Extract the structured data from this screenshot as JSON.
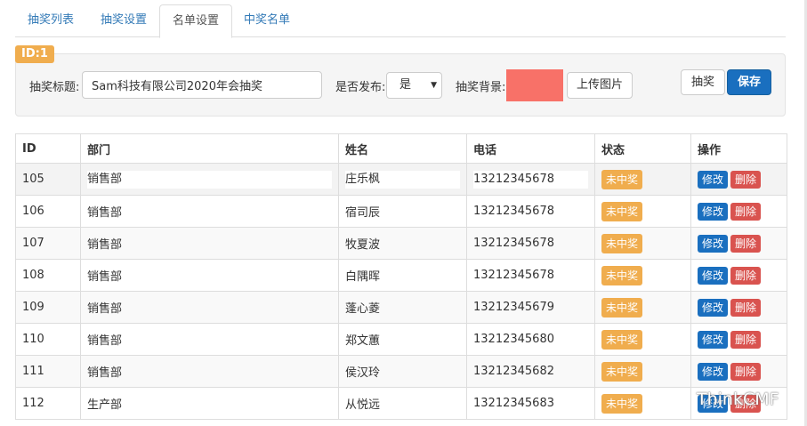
{
  "tabs": [
    "抽奖列表",
    "抽奖设置",
    "名单设置",
    "中奖名单"
  ],
  "active_tab": 2,
  "form": {
    "id_badge": "ID:1",
    "title_label": "抽奖标题:",
    "title_value": "Sam科技有限公司2020年会抽奖",
    "publish_label": "是否发布:",
    "publish_value": "是",
    "bg_label": "抽奖背景:",
    "bg_color": "#f87168",
    "upload_button": "上传图片",
    "draw_button": "抽奖",
    "save_button": "保存"
  },
  "table": {
    "headers": [
      "ID",
      "部门",
      "姓名",
      "电话",
      "状态",
      "操作"
    ],
    "rows": [
      {
        "id": "105",
        "dept": "销售部",
        "name": "庄乐枫",
        "phone": "13212345678",
        "status": "未中奖",
        "edit": "修改",
        "del": "删除"
      },
      {
        "id": "106",
        "dept": "销售部",
        "name": "宿司辰",
        "phone": "13212345678",
        "status": "未中奖",
        "edit": "修改",
        "del": "删除"
      },
      {
        "id": "107",
        "dept": "销售部",
        "name": "牧夏波",
        "phone": "13212345678",
        "status": "未中奖",
        "edit": "修改",
        "del": "删除"
      },
      {
        "id": "108",
        "dept": "销售部",
        "name": "白隅晖",
        "phone": "13212345678",
        "status": "未中奖",
        "edit": "修改",
        "del": "删除"
      },
      {
        "id": "109",
        "dept": "销售部",
        "name": "蓬心菱",
        "phone": "13212345679",
        "status": "未中奖",
        "edit": "修改",
        "del": "删除"
      },
      {
        "id": "110",
        "dept": "销售部",
        "name": "郑文蕙",
        "phone": "13212345680",
        "status": "未中奖",
        "edit": "修改",
        "del": "删除"
      },
      {
        "id": "111",
        "dept": "销售部",
        "name": "侯汉玲",
        "phone": "13212345682",
        "status": "未中奖",
        "edit": "修改",
        "del": "删除"
      },
      {
        "id": "112",
        "dept": "生产部",
        "name": "从悦远",
        "phone": "13212345683",
        "status": "未中奖",
        "edit": "修改",
        "del": "删除"
      }
    ]
  },
  "watermark": "ThinkCMF",
  "colors": {
    "primary": "#1a6fbf",
    "warning": "#f0ad4e",
    "danger": "#d9534f",
    "link": "#337ab7"
  }
}
